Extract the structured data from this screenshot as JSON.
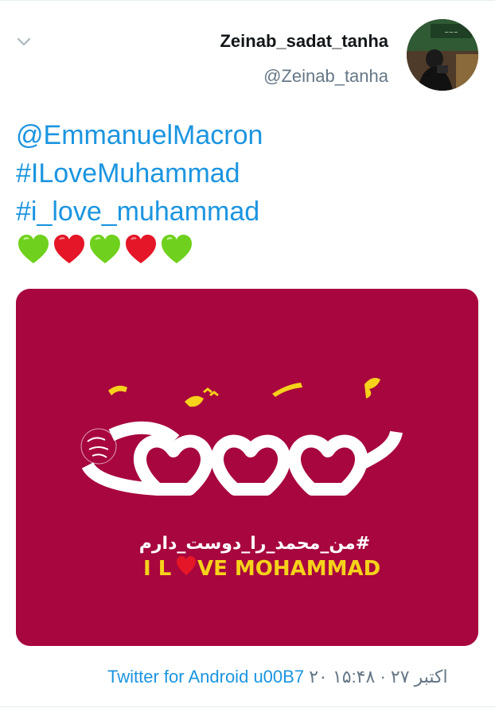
{
  "tweet": {
    "author": {
      "display_name": "Zeinab_sadat_tanha",
      "handle": "@Zeinab_tanha"
    },
    "text_lines": [
      "@EmmanuelMacron",
      "#ILoveMuhammad",
      "#i_love_muhammad"
    ],
    "emojis": [
      "green-heart",
      "red-heart",
      "green-heart",
      "red-heart",
      "green-heart"
    ],
    "media": {
      "persian_tag": "#من_محمد_را_دوست_دارم",
      "english_prefix": "I L",
      "english_suffix": "VE MOHAMMAD",
      "background_color": "#a8063e",
      "accent_color": "#f6d21a"
    },
    "meta": {
      "source": "Twitter for Android",
      "separator": "u00B7",
      "date": "۲۰ اکتبر ۲۷ · ۱۵:۴۸"
    }
  },
  "colors": {
    "link": "#1b95e0",
    "secondary": "#657786",
    "heart_green": "#6fd11e",
    "heart_red": "#e51627"
  }
}
